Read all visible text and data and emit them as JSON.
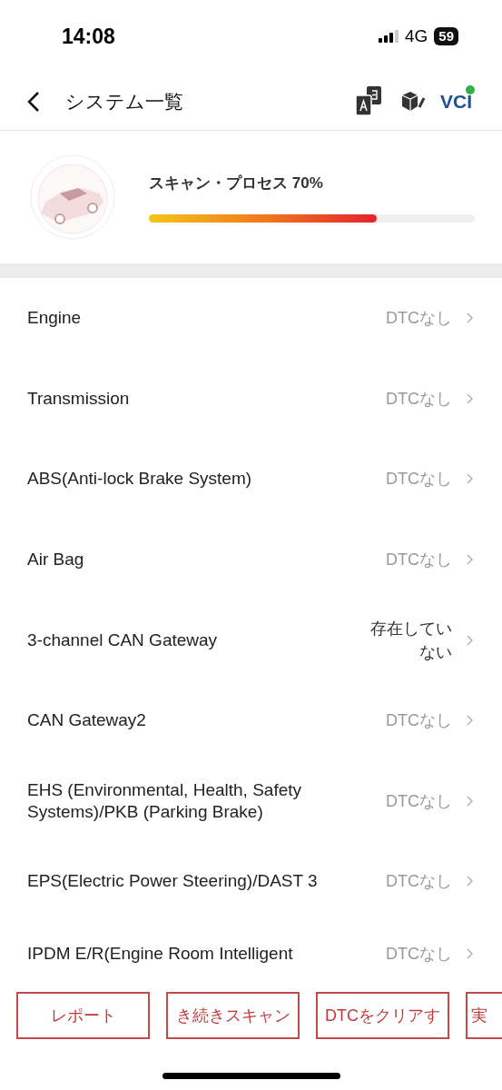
{
  "status_bar": {
    "time": "14:08",
    "network": "4G",
    "battery": "59"
  },
  "header": {
    "title": "システム一覧",
    "vci": "VCI"
  },
  "scan": {
    "label": "スキャン・プロセス 70%",
    "level": 0.7
  },
  "systems": [
    {
      "name": "Engine",
      "status": "DTCなし",
      "kind": "ok"
    },
    {
      "name": "Transmission",
      "status": "DTCなし",
      "kind": "ok"
    },
    {
      "name": "ABS(Anti-lock Brake System)",
      "status": "DTCなし",
      "kind": "ok"
    },
    {
      "name": "Air Bag",
      "status": "DTCなし",
      "kind": "ok"
    },
    {
      "name": "3-channel CAN Gateway",
      "status": "存在していない",
      "kind": "absent"
    },
    {
      "name": "CAN Gateway2",
      "status": "DTCなし",
      "kind": "ok"
    },
    {
      "name": "EHS (Environmental, Health, Safety Systems)/PKB (Parking Brake)",
      "status": "DTCなし",
      "kind": "ok"
    },
    {
      "name": "EPS(Electric Power Steering)/DAST 3",
      "status": "DTCなし",
      "kind": "ok"
    },
    {
      "name": "IPDM E/R(Engine Room Intelligent",
      "status": "DTCなし",
      "kind": "ok"
    }
  ],
  "buttons": [
    "レポート",
    "き続きスキャン",
    "DTCをクリアす",
    "実"
  ]
}
